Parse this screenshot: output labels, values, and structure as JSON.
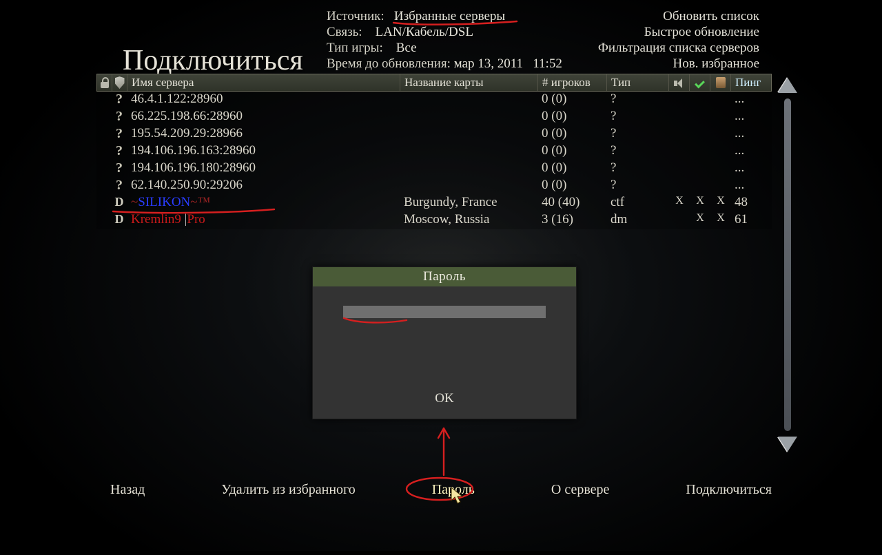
{
  "title": "Подключиться",
  "info": {
    "source_label": "Источник:",
    "source_value": "Избранные серверы",
    "conn_label": "Связь:",
    "conn_value": "LAN/Кабель/DSL",
    "gametype_label": "Тип игры:",
    "gametype_value": "Все",
    "refresh_label": "Время до обновления:",
    "refresh_value": "мар 13, 2011   11:52"
  },
  "right_menu": {
    "i0": "Обновить список",
    "i1": "Быстрое обновление",
    "i2": "Фильтрация списка серверов",
    "i3": "Нов. избранное"
  },
  "cols": {
    "name": "Имя сервера",
    "map": "Название карты",
    "players": "# игроков",
    "type": "Тип",
    "ping": "Пинг"
  },
  "srv": {
    "r0": {
      "icon": "?",
      "name": "46.4.1.122:28960",
      "map": "",
      "players": "0 (0)",
      "type": "?",
      "s": "",
      "c": "",
      "h": "",
      "ping": "..."
    },
    "r1": {
      "icon": "?",
      "name": "66.225.198.66:28960",
      "map": "",
      "players": "0 (0)",
      "type": "?",
      "s": "",
      "c": "",
      "h": "",
      "ping": "..."
    },
    "r2": {
      "icon": "?",
      "name": "195.54.209.29:28966",
      "map": "",
      "players": "0 (0)",
      "type": "?",
      "s": "",
      "c": "",
      "h": "",
      "ping": "..."
    },
    "r3": {
      "icon": "?",
      "name": "194.106.196.163:28960",
      "map": "",
      "players": "0 (0)",
      "type": "?",
      "s": "",
      "c": "",
      "h": "",
      "ping": "..."
    },
    "r4": {
      "icon": "?",
      "name": "194.106.196.180:28960",
      "map": "",
      "players": "0 (0)",
      "type": "?",
      "s": "",
      "c": "",
      "h": "",
      "ping": "..."
    },
    "r5": {
      "icon": "?",
      "name": "62.140.250.90:29206",
      "map": "",
      "players": "0 (0)",
      "type": "?",
      "s": "",
      "c": "",
      "h": "",
      "ping": "..."
    },
    "r6": {
      "icon": "D",
      "name_pre": "~",
      "name_mid": "SILIKON",
      "name_post": "~™",
      "map": "Burgundy, France",
      "players": "40 (40)",
      "type": "ctf",
      "s": "X",
      "c": "X",
      "h": "X",
      "ping": "48"
    },
    "r7": {
      "icon": "D",
      "name_a": "Kremlin9 ",
      "name_b": "|",
      "name_c": "Pro",
      "map": "Moscow, Russia",
      "players": "3 (16)",
      "type": "dm",
      "s": "",
      "c": "X",
      "h": "X",
      "ping": "61"
    }
  },
  "modal": {
    "title": "Пароль",
    "ok": "OK",
    "value": ""
  },
  "footer": {
    "back": "Назад",
    "delfav": "Удалить из избранного",
    "password": "Пароль",
    "about": "О сервере",
    "connect": "Подключиться"
  }
}
